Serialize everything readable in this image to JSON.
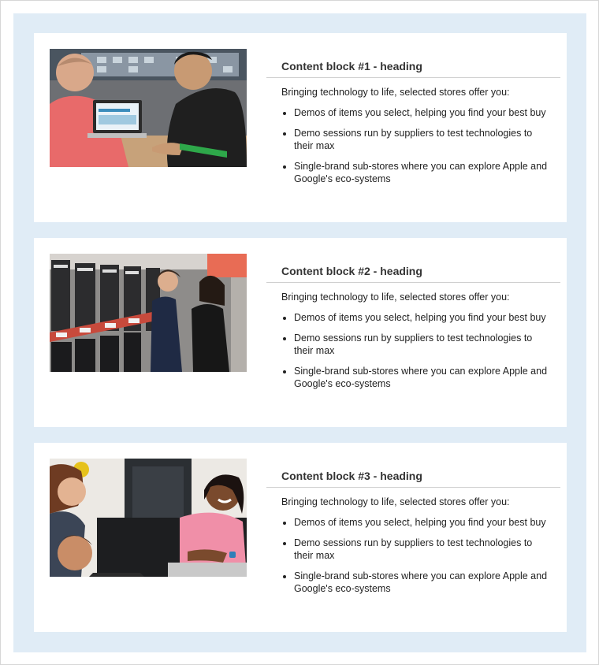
{
  "cards": [
    {
      "heading": "Content block #1 - heading",
      "intro": "Bringing technology to life, selected stores offer you:",
      "bullets": [
        "Demos of items you select, helping you find your best buy",
        "Demo sessions run by suppliers to test technologies to their max",
        "Single-brand sub-stores where you can explore Apple and Google's eco-systems"
      ]
    },
    {
      "heading": "Content block #2 - heading",
      "intro": "Bringing technology to life, selected stores offer you:",
      "bullets": [
        "Demos of items you select, helping you find your best buy",
        "Demo sessions run by suppliers to test technologies to their max",
        "Single-brand sub-stores where you can explore Apple and Google's eco-systems"
      ]
    },
    {
      "heading": "Content block #3 - heading",
      "intro": "Bringing technology to life, selected stores offer you:",
      "bullets": [
        "Demos of items you select, helping you find your best buy",
        "Demo sessions run by suppliers to test technologies to their max",
        "Single-brand sub-stores where you can explore Apple and Google's eco-systems"
      ]
    }
  ],
  "colors": {
    "panel_background": "#e0ecf6",
    "card_background": "#ffffff",
    "divider": "#d0d0d0"
  }
}
